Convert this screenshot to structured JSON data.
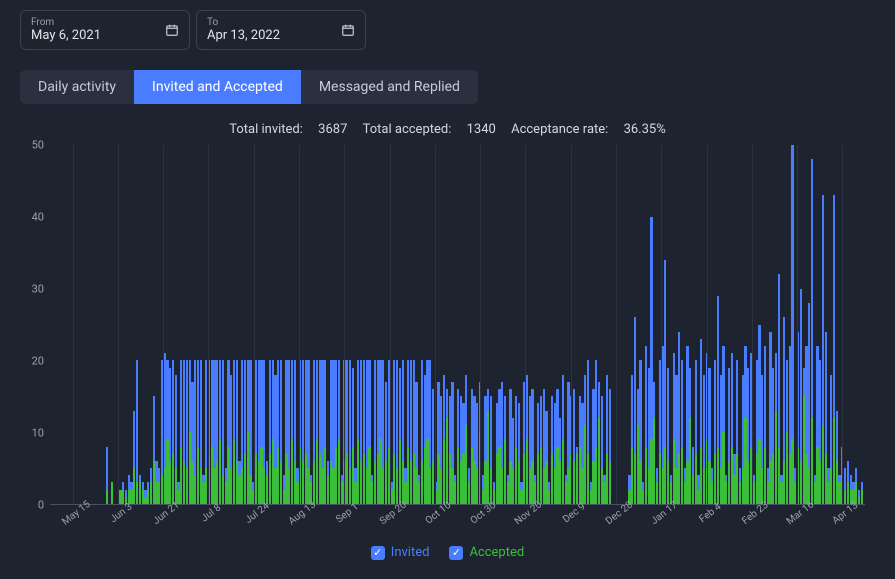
{
  "date_range": {
    "from_label": "From",
    "from_value": "May 6, 2021",
    "to_label": "To",
    "to_value": "Apr 13, 2022"
  },
  "tabs": {
    "daily": "Daily activity",
    "invited": "Invited and Accepted",
    "messaged": "Messaged and Replied"
  },
  "summary": {
    "total_invited_label": "Total invited:",
    "total_invited_value": "3687",
    "total_accepted_label": "Total accepted:",
    "total_accepted_value": "1340",
    "acceptance_rate_label": "Acceptance rate:",
    "acceptance_rate_value": "36.35%"
  },
  "legend": {
    "invited": "Invited",
    "accepted": "Accepted"
  },
  "chart_data": {
    "type": "bar",
    "title": "Total invited: 3687  Total accepted: 1340  Acceptance rate: 36.35%",
    "ylabel": "",
    "ylim": [
      0,
      50
    ],
    "y_ticks": [
      0,
      10,
      20,
      30,
      40,
      50
    ],
    "x_tick_labels": [
      "May 15",
      "Jun 3",
      "Jun 21",
      "Jul 8",
      "Jul 24",
      "Aug 13",
      "Sep 1",
      "Sep 20",
      "Oct 10",
      "Oct 30",
      "Nov 20",
      "Dec 9",
      "Dec 28",
      "Jan 17",
      "Feb 4",
      "Feb 23",
      "Mar 16",
      "Apr 13"
    ],
    "series": [
      {
        "name": "Invited",
        "color": "#4a7cff"
      },
      {
        "name": "Accepted",
        "color": "#3bbf3b"
      }
    ],
    "days": [
      {
        "inv": 0,
        "acc": 0
      },
      {
        "inv": 0,
        "acc": 0
      },
      {
        "inv": 0,
        "acc": 0
      },
      {
        "inv": 0,
        "acc": 0
      },
      {
        "inv": 0,
        "acc": 0
      },
      {
        "inv": 0,
        "acc": 0
      },
      {
        "inv": 0,
        "acc": 0
      },
      {
        "inv": 0,
        "acc": 0
      },
      {
        "inv": 0,
        "acc": 0
      },
      {
        "inv": 0,
        "acc": 0
      },
      {
        "inv": 0,
        "acc": 0
      },
      {
        "inv": 0,
        "acc": 0
      },
      {
        "inv": 0,
        "acc": 0
      },
      {
        "inv": 0,
        "acc": 0
      },
      {
        "inv": 0,
        "acc": 0
      },
      {
        "inv": 0,
        "acc": 0
      },
      {
        "inv": 0,
        "acc": 0
      },
      {
        "inv": 0,
        "acc": 0
      },
      {
        "inv": 0,
        "acc": 0
      },
      {
        "inv": 0,
        "acc": 0
      },
      {
        "inv": 8,
        "acc": 2
      },
      {
        "inv": 0,
        "acc": 0
      },
      {
        "inv": 3,
        "acc": 3
      },
      {
        "inv": 0,
        "acc": 0
      },
      {
        "inv": 0,
        "acc": 0
      },
      {
        "inv": 2,
        "acc": 2
      },
      {
        "inv": 3,
        "acc": 2
      },
      {
        "inv": 2,
        "acc": 1
      },
      {
        "inv": 4,
        "acc": 2
      },
      {
        "inv": 3,
        "acc": 2
      },
      {
        "inv": 13,
        "acc": 5
      },
      {
        "inv": 20,
        "acc": 3
      },
      {
        "inv": 4,
        "acc": 3
      },
      {
        "inv": 3,
        "acc": 2
      },
      {
        "inv": 2,
        "acc": 1
      },
      {
        "inv": 3,
        "acc": 2
      },
      {
        "inv": 5,
        "acc": 3
      },
      {
        "inv": 15,
        "acc": 6
      },
      {
        "inv": 6,
        "acc": 3
      },
      {
        "inv": 5,
        "acc": 3
      },
      {
        "inv": 20,
        "acc": 4
      },
      {
        "inv": 21,
        "acc": 5
      },
      {
        "inv": 20,
        "acc": 9
      },
      {
        "inv": 19,
        "acc": 6
      },
      {
        "inv": 20,
        "acc": 7
      },
      {
        "inv": 18,
        "acc": 5
      },
      {
        "inv": 3,
        "acc": 2
      },
      {
        "inv": 20,
        "acc": 8
      },
      {
        "inv": 20,
        "acc": 6
      },
      {
        "inv": 20,
        "acc": 5
      },
      {
        "inv": 20,
        "acc": 10
      },
      {
        "inv": 17,
        "acc": 6
      },
      {
        "inv": 20,
        "acc": 4
      },
      {
        "inv": 20,
        "acc": 8
      },
      {
        "inv": 20,
        "acc": 5
      },
      {
        "inv": 4,
        "acc": 3
      },
      {
        "inv": 20,
        "acc": 5
      },
      {
        "inv": 20,
        "acc": 7
      },
      {
        "inv": 20,
        "acc": 8
      },
      {
        "inv": 20,
        "acc": 5
      },
      {
        "inv": 20,
        "acc": 6
      },
      {
        "inv": 20,
        "acc": 9
      },
      {
        "inv": 20,
        "acc": 4
      },
      {
        "inv": 5,
        "acc": 3
      },
      {
        "inv": 20,
        "acc": 8
      },
      {
        "inv": 18,
        "acc": 5
      },
      {
        "inv": 20,
        "acc": 9
      },
      {
        "inv": 20,
        "acc": 6
      },
      {
        "inv": 6,
        "acc": 4
      },
      {
        "inv": 20,
        "acc": 5
      },
      {
        "inv": 20,
        "acc": 7
      },
      {
        "inv": 20,
        "acc": 10
      },
      {
        "inv": 20,
        "acc": 4
      },
      {
        "inv": 3,
        "acc": 2
      },
      {
        "inv": 20,
        "acc": 7
      },
      {
        "inv": 20,
        "acc": 6
      },
      {
        "inv": 20,
        "acc": 8
      },
      {
        "inv": 20,
        "acc": 5
      },
      {
        "inv": 6,
        "acc": 4
      },
      {
        "inv": 20,
        "acc": 7
      },
      {
        "inv": 20,
        "acc": 9
      },
      {
        "inv": 18,
        "acc": 5
      },
      {
        "inv": 20,
        "acc": 8
      },
      {
        "inv": 20,
        "acc": 6
      },
      {
        "inv": 4,
        "acc": 2
      },
      {
        "inv": 20,
        "acc": 7
      },
      {
        "inv": 20,
        "acc": 5
      },
      {
        "inv": 20,
        "acc": 9
      },
      {
        "inv": 20,
        "acc": 6
      },
      {
        "inv": 5,
        "acc": 3
      },
      {
        "inv": 20,
        "acc": 8
      },
      {
        "inv": 20,
        "acc": 6
      },
      {
        "inv": 20,
        "acc": 7
      },
      {
        "inv": 20,
        "acc": 5
      },
      {
        "inv": 4,
        "acc": 3
      },
      {
        "inv": 20,
        "acc": 6
      },
      {
        "inv": 20,
        "acc": 9
      },
      {
        "inv": 20,
        "acc": 7
      },
      {
        "inv": 20,
        "acc": 5
      },
      {
        "inv": 20,
        "acc": 8
      },
      {
        "inv": 6,
        "acc": 4
      },
      {
        "inv": 20,
        "acc": 6
      },
      {
        "inv": 20,
        "acc": 5
      },
      {
        "inv": 20,
        "acc": 8
      },
      {
        "inv": 20,
        "acc": 9
      },
      {
        "inv": 4,
        "acc": 3
      },
      {
        "inv": 20,
        "acc": 6
      },
      {
        "inv": 20,
        "acc": 7
      },
      {
        "inv": 20,
        "acc": 5
      },
      {
        "inv": 19,
        "acc": 8
      },
      {
        "inv": 5,
        "acc": 3
      },
      {
        "inv": 20,
        "acc": 9
      },
      {
        "inv": 20,
        "acc": 6
      },
      {
        "inv": 20,
        "acc": 7
      },
      {
        "inv": 20,
        "acc": 5
      },
      {
        "inv": 20,
        "acc": 8
      },
      {
        "inv": 4,
        "acc": 3
      },
      {
        "inv": 20,
        "acc": 6
      },
      {
        "inv": 20,
        "acc": 7
      },
      {
        "inv": 20,
        "acc": 9
      },
      {
        "inv": 20,
        "acc": 5
      },
      {
        "inv": 17,
        "acc": 6
      },
      {
        "inv": 20,
        "acc": 8
      },
      {
        "inv": 3,
        "acc": 2
      },
      {
        "inv": 20,
        "acc": 7
      },
      {
        "inv": 20,
        "acc": 5
      },
      {
        "inv": 19,
        "acc": 9
      },
      {
        "inv": 20,
        "acc": 6
      },
      {
        "inv": 5,
        "acc": 3
      },
      {
        "inv": 20,
        "acc": 8
      },
      {
        "inv": 20,
        "acc": 6
      },
      {
        "inv": 20,
        "acc": 7
      },
      {
        "inv": 17,
        "acc": 5
      },
      {
        "inv": 4,
        "acc": 3
      },
      {
        "inv": 20,
        "acc": 6
      },
      {
        "inv": 18,
        "acc": 8
      },
      {
        "inv": 20,
        "acc": 9
      },
      {
        "inv": 20,
        "acc": 5
      },
      {
        "inv": 16,
        "acc": 6
      },
      {
        "inv": 3,
        "acc": 2
      },
      {
        "inv": 17,
        "acc": 7
      },
      {
        "inv": 15,
        "acc": 5
      },
      {
        "inv": 18,
        "acc": 9
      },
      {
        "inv": 16,
        "acc": 12
      },
      {
        "inv": 15,
        "acc": 7
      },
      {
        "inv": 17,
        "acc": 5
      },
      {
        "inv": 4,
        "acc": 3
      },
      {
        "inv": 16,
        "acc": 8
      },
      {
        "inv": 15,
        "acc": 6
      },
      {
        "inv": 14,
        "acc": 7
      },
      {
        "inv": 18,
        "acc": 11
      },
      {
        "inv": 5,
        "acc": 3
      },
      {
        "inv": 16,
        "acc": 8
      },
      {
        "inv": 15,
        "acc": 6
      },
      {
        "inv": 14,
        "acc": 5
      },
      {
        "inv": 17,
        "acc": 10
      },
      {
        "inv": 4,
        "acc": 2
      },
      {
        "inv": 15,
        "acc": 6
      },
      {
        "inv": 16,
        "acc": 13
      },
      {
        "inv": 15,
        "acc": 5
      },
      {
        "inv": 3,
        "acc": 2
      },
      {
        "inv": 14,
        "acc": 7
      },
      {
        "inv": 16,
        "acc": 8
      },
      {
        "inv": 17,
        "acc": 5
      },
      {
        "inv": 15,
        "acc": 9
      },
      {
        "inv": 4,
        "acc": 3
      },
      {
        "inv": 16,
        "acc": 6
      },
      {
        "inv": 12,
        "acc": 5
      },
      {
        "inv": 15,
        "acc": 8
      },
      {
        "inv": 14,
        "acc": 6
      },
      {
        "inv": 3,
        "acc": 2
      },
      {
        "inv": 17,
        "acc": 7
      },
      {
        "inv": 18,
        "acc": 9
      },
      {
        "inv": 15,
        "acc": 5
      },
      {
        "inv": 16,
        "acc": 6
      },
      {
        "inv": 4,
        "acc": 3
      },
      {
        "inv": 14,
        "acc": 7
      },
      {
        "inv": 15,
        "acc": 8
      },
      {
        "inv": 16,
        "acc": 5
      },
      {
        "inv": 13,
        "acc": 6
      },
      {
        "inv": 3,
        "acc": 2
      },
      {
        "inv": 15,
        "acc": 7
      },
      {
        "inv": 14,
        "acc": 5
      },
      {
        "inv": 16,
        "acc": 8
      },
      {
        "inv": 12,
        "acc": 6
      },
      {
        "inv": 18,
        "acc": 9
      },
      {
        "inv": 4,
        "acc": 3
      },
      {
        "inv": 17,
        "acc": 5
      },
      {
        "inv": 15,
        "acc": 7
      },
      {
        "inv": 16,
        "acc": 6
      },
      {
        "inv": 8,
        "acc": 7
      },
      {
        "inv": 15,
        "acc": 8
      },
      {
        "inv": 14,
        "acc": 5
      },
      {
        "inv": 18,
        "acc": 11
      },
      {
        "inv": 20,
        "acc": 7
      },
      {
        "inv": 3,
        "acc": 2
      },
      {
        "inv": 16,
        "acc": 6
      },
      {
        "inv": 20,
        "acc": 8
      },
      {
        "inv": 17,
        "acc": 12
      },
      {
        "inv": 15,
        "acc": 5
      },
      {
        "inv": 4,
        "acc": 3
      },
      {
        "inv": 18,
        "acc": 7
      },
      {
        "inv": 16,
        "acc": 6
      },
      {
        "inv": 0,
        "acc": 0
      },
      {
        "inv": 0,
        "acc": 0
      },
      {
        "inv": 0,
        "acc": 0
      },
      {
        "inv": 0,
        "acc": 0
      },
      {
        "inv": 0,
        "acc": 0
      },
      {
        "inv": 0,
        "acc": 0
      },
      {
        "inv": 4,
        "acc": 2
      },
      {
        "inv": 18,
        "acc": 8
      },
      {
        "inv": 26,
        "acc": 7
      },
      {
        "inv": 16,
        "acc": 11
      },
      {
        "inv": 20,
        "acc": 6
      },
      {
        "inv": 3,
        "acc": 2
      },
      {
        "inv": 22,
        "acc": 8
      },
      {
        "inv": 19,
        "acc": 5
      },
      {
        "inv": 40,
        "acc": 9
      },
      {
        "inv": 17,
        "acc": 12
      },
      {
        "inv": 5,
        "acc": 3
      },
      {
        "inv": 20,
        "acc": 7
      },
      {
        "inv": 22,
        "acc": 5
      },
      {
        "inv": 34,
        "acc": 8
      },
      {
        "inv": 19,
        "acc": 6
      },
      {
        "inv": 4,
        "acc": 3
      },
      {
        "inv": 21,
        "acc": 9
      },
      {
        "inv": 18,
        "acc": 5
      },
      {
        "inv": 24,
        "acc": 7
      },
      {
        "inv": 20,
        "acc": 8
      },
      {
        "inv": 5,
        "acc": 3
      },
      {
        "inv": 22,
        "acc": 6
      },
      {
        "inv": 19,
        "acc": 12
      },
      {
        "inv": 8,
        "acc": 4
      },
      {
        "inv": 20,
        "acc": 7
      },
      {
        "inv": 4,
        "acc": 2
      },
      {
        "inv": 23,
        "acc": 8
      },
      {
        "inv": 18,
        "acc": 5
      },
      {
        "inv": 21,
        "acc": 9
      },
      {
        "inv": 19,
        "acc": 6
      },
      {
        "inv": 5,
        "acc": 3
      },
      {
        "inv": 20,
        "acc": 7
      },
      {
        "inv": 29,
        "acc": 8
      },
      {
        "inv": 18,
        "acc": 5
      },
      {
        "inv": 22,
        "acc": 10
      },
      {
        "inv": 4,
        "acc": 3
      },
      {
        "inv": 19,
        "acc": 6
      },
      {
        "inv": 21,
        "acc": 8
      },
      {
        "inv": 7,
        "acc": 4
      },
      {
        "inv": 20,
        "acc": 7
      },
      {
        "inv": 5,
        "acc": 3
      },
      {
        "inv": 18,
        "acc": 5
      },
      {
        "inv": 22,
        "acc": 12
      },
      {
        "inv": 19,
        "acc": 6
      },
      {
        "inv": 21,
        "acc": 8
      },
      {
        "inv": 4,
        "acc": 3
      },
      {
        "inv": 20,
        "acc": 7
      },
      {
        "inv": 25,
        "acc": 9
      },
      {
        "inv": 18,
        "acc": 5
      },
      {
        "inv": 22,
        "acc": 8
      },
      {
        "inv": 5,
        "acc": 3
      },
      {
        "inv": 24,
        "acc": 6
      },
      {
        "inv": 19,
        "acc": 7
      },
      {
        "inv": 21,
        "acc": 13
      },
      {
        "inv": 32,
        "acc": 8
      },
      {
        "inv": 4,
        "acc": 3
      },
      {
        "inv": 26,
        "acc": 6
      },
      {
        "inv": 20,
        "acc": 10
      },
      {
        "inv": 22,
        "acc": 7
      },
      {
        "inv": 51,
        "acc": 9
      },
      {
        "inv": 5,
        "acc": 3
      },
      {
        "inv": 24,
        "acc": 8
      },
      {
        "inv": 30,
        "acc": 6
      },
      {
        "inv": 19,
        "acc": 15
      },
      {
        "inv": 22,
        "acc": 7
      },
      {
        "inv": 28,
        "acc": 5
      },
      {
        "inv": 48,
        "acc": 12
      },
      {
        "inv": 4,
        "acc": 3
      },
      {
        "inv": 22,
        "acc": 8
      },
      {
        "inv": 20,
        "acc": 6
      },
      {
        "inv": 43,
        "acc": 11
      },
      {
        "inv": 24,
        "acc": 7
      },
      {
        "inv": 5,
        "acc": 3
      },
      {
        "inv": 18,
        "acc": 5
      },
      {
        "inv": 43,
        "acc": 12
      },
      {
        "inv": 13,
        "acc": 6
      },
      {
        "inv": 4,
        "acc": 3
      },
      {
        "inv": 8,
        "acc": 4
      },
      {
        "inv": 5,
        "acc": 2
      },
      {
        "inv": 6,
        "acc": 3
      },
      {
        "inv": 4,
        "acc": 2
      },
      {
        "inv": 3,
        "acc": 2
      },
      {
        "inv": 5,
        "acc": 3
      },
      {
        "inv": 2,
        "acc": 1
      },
      {
        "inv": 3,
        "acc": 2
      }
    ]
  }
}
